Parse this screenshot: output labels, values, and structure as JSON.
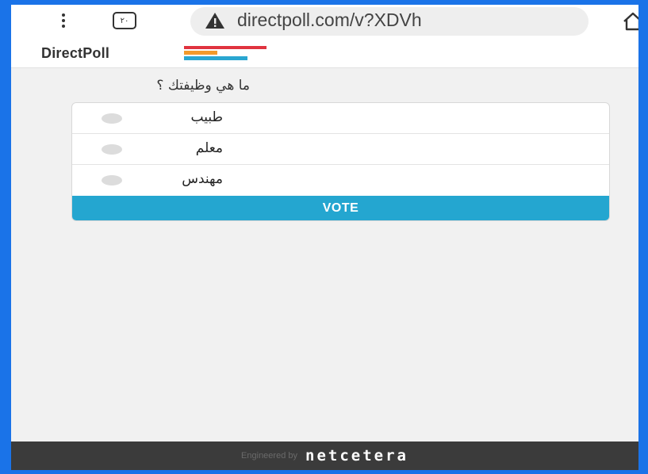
{
  "browser": {
    "tab_count": "٢٠",
    "url": "directpoll.com/v?XDVh"
  },
  "site": {
    "logo_text": "DirectPoll",
    "logo_colors": [
      "#e0333f",
      "#f39a2b",
      "#2aa6d1"
    ]
  },
  "poll": {
    "question": "ما هي وظيفتك ؟",
    "options": [
      {
        "label": "طبيب"
      },
      {
        "label": "معلم"
      },
      {
        "label": "مهندس"
      }
    ],
    "vote_label": "VOTE"
  },
  "footer": {
    "engineered_by": "Engineered by",
    "brand": "netcetera"
  },
  "colors": {
    "frame": "#1a73e8",
    "vote_button": "#24a6d0",
    "footer_bg": "#3b3b3b"
  }
}
